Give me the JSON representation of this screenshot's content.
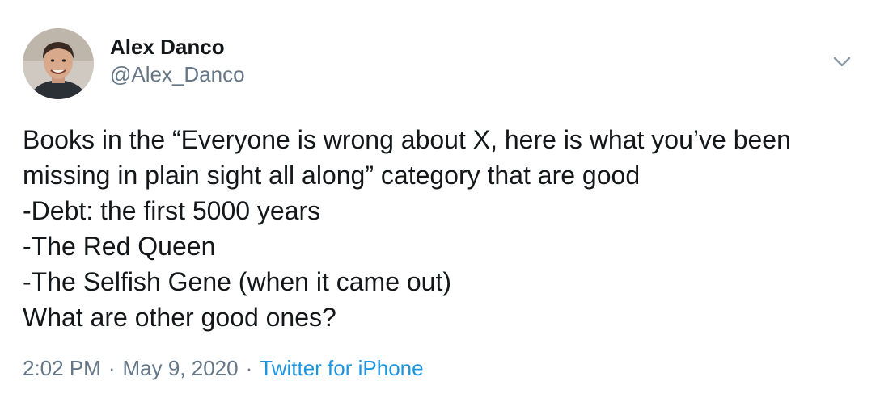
{
  "author": {
    "display_name": "Alex Danco",
    "handle": "@Alex_Danco",
    "avatar_icon": "user-avatar-photo"
  },
  "tweet": {
    "lines": [
      "Books in the “Everyone is wrong about X, here is what you’ve been",
      "missing in plain sight all along” category that are good",
      "-Debt: the first 5000 years",
      "-The Red Queen",
      "-The Selfish Gene (when it came out)",
      "What are other good ones?"
    ]
  },
  "meta": {
    "time": "2:02 PM",
    "separator": "·",
    "date": "May 9, 2020",
    "source": "Twitter for iPhone"
  },
  "menu": {
    "icon": "chevron-down-icon"
  },
  "colors": {
    "text": "#14171a",
    "secondary": "#657786",
    "link": "#1b95e0",
    "chevron": "#8899a6"
  }
}
